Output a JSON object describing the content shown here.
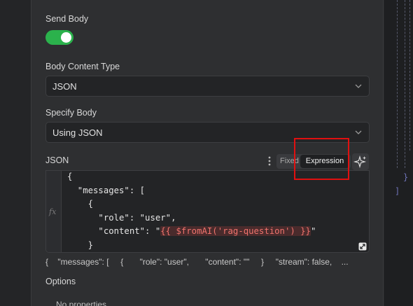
{
  "send_body": {
    "label": "Send Body",
    "enabled": true
  },
  "body_content_type": {
    "label": "Body Content Type",
    "value": "JSON"
  },
  "specify_body": {
    "label": "Specify Body",
    "value": "Using JSON"
  },
  "json_field": {
    "label": "JSON",
    "mode_fixed": "Fixed",
    "mode_expression": "Expression",
    "code_lines": [
      "{",
      "  \"messages\": [",
      "    {",
      "      \"role\": \"user\",",
      "      \"content\": \"",
      "    }"
    ],
    "content_template": "{{ $fromAI('rag-question') }}",
    "content_suffix": "\"",
    "gutter_symbol": "fx",
    "preview": "{    \"messages\": [     {       \"role\": \"user\",       \"content\": \"\"     }     \"stream\": false,    ..."
  },
  "options": {
    "label": "Options",
    "empty_text": "No properties"
  },
  "right_canvas": {
    "brace_inner": "}",
    "bracket": "]"
  },
  "colors": {
    "toggle_on": "#2bb24c",
    "highlight": "#e01010",
    "template": "#f0736d"
  },
  "icons": [
    "chevron-down-icon",
    "kebab-icon",
    "sparkle-icon",
    "resize-icon"
  ]
}
